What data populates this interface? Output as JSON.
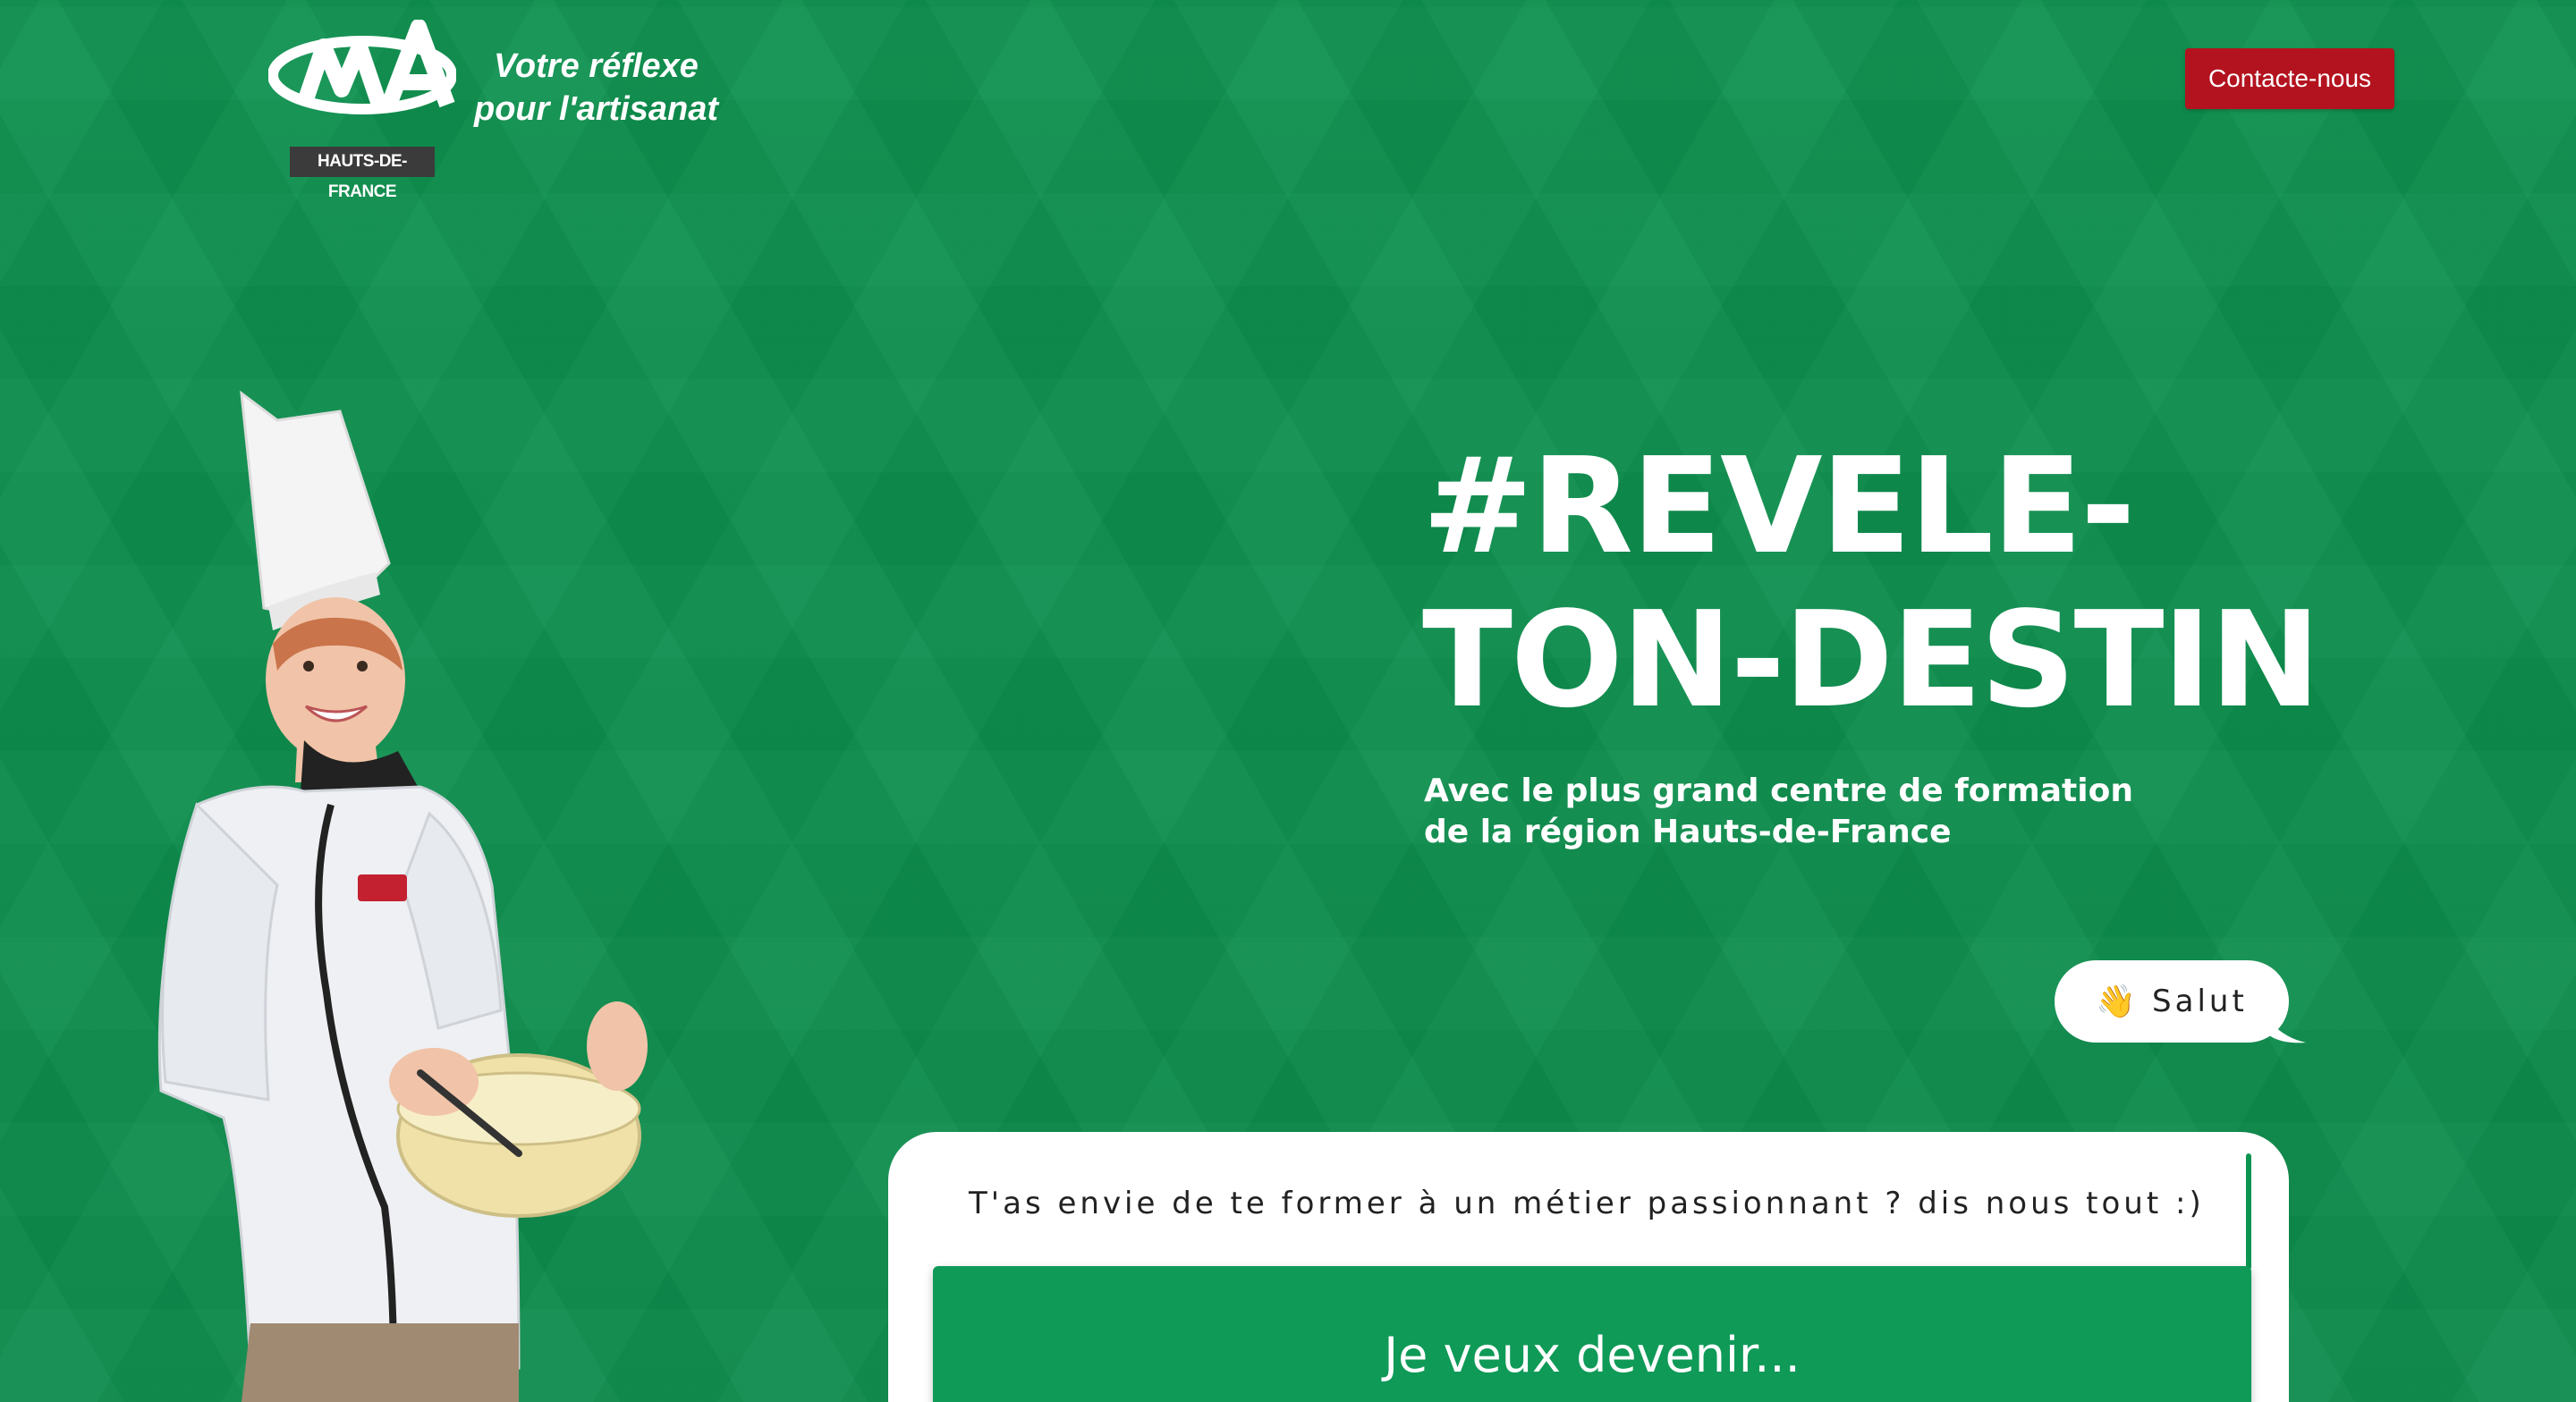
{
  "header": {
    "logo_letters": "CMA",
    "logo_region": "HAUTS-DE-FRANCE",
    "tagline_line1": "Votre réflexe",
    "tagline_line2": "pour l'artisanat",
    "contact_label": "Contacte-nous"
  },
  "hero": {
    "title_line1": "#REVELE-",
    "title_line2": "TON-DESTIN",
    "subtitle_line1": "Avec le plus grand centre de formation",
    "subtitle_line2": "de la région Hauts-de-France"
  },
  "chat": {
    "greeting_icon": "waving-hand-icon",
    "greeting_emoji": "👋",
    "greeting_text": "Salut",
    "prompt": "T'as envie de te former à un métier passionnant ? dis nous tout :)",
    "choice_label": "Je veux devenir..."
  },
  "colors": {
    "background": "#0e9451",
    "contact_button": "#b3131f",
    "choice_button": "#0f9a57",
    "logo_dark": "#3b3b3b"
  }
}
